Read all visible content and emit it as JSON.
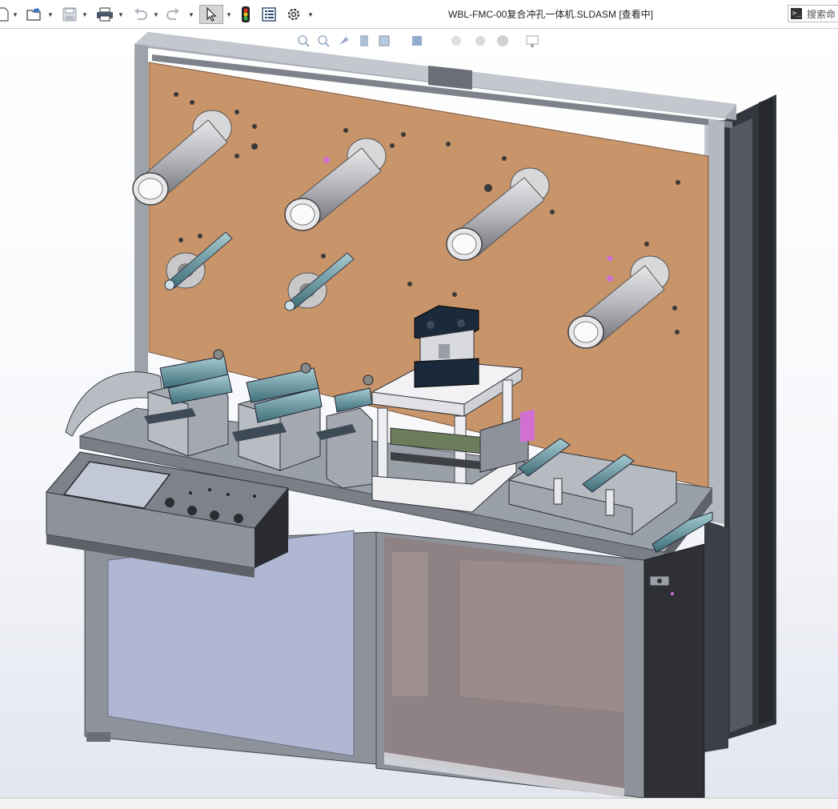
{
  "window": {
    "title": "WBL-FMC-00复合冲孔一体机.SLDASM [查看中]"
  },
  "toolbar": {
    "items": [
      {
        "icon": "new-document-icon",
        "has_dropdown": true
      },
      {
        "icon": "open-folder-icon",
        "has_dropdown": true
      },
      {
        "icon": "save-icon",
        "has_dropdown": true,
        "disabled": true
      },
      {
        "icon": "print-icon",
        "has_dropdown": true
      },
      {
        "icon": "undo-icon",
        "has_dropdown": true,
        "disabled": true
      },
      {
        "icon": "redo-icon",
        "has_dropdown": true,
        "disabled": true
      },
      {
        "icon": "select-pointer-icon",
        "has_dropdown": true,
        "active": true
      },
      {
        "icon": "traffic-light-icon",
        "has_dropdown": false
      },
      {
        "icon": "file-properties-icon",
        "has_dropdown": false
      },
      {
        "icon": "options-gear-icon",
        "has_dropdown": true
      }
    ]
  },
  "search": {
    "placeholder": "搜索命",
    "icon": "command-prompt-icon"
  },
  "heads_up_toolbar": {
    "icons": [
      "zoom-to-fit-icon",
      "zoom-area-icon",
      "previous-view-icon",
      "section-view-icon",
      "view-orientation-icon",
      "display-style-icon",
      "hide-show-icon",
      "edit-appearance-icon",
      "apply-scene-icon",
      "view-settings-icon"
    ]
  },
  "colors": {
    "panel_orange": "#c8946a",
    "frame_gray": "#9aa0a8",
    "dark_frame": "#33353b",
    "cabinet_panel": "#b0b7d2",
    "viewport_top": "#ffffff",
    "viewport_bottom": "#e3e6ef",
    "cylinder_dark": "#1a2a3a",
    "roller_teal": "#6aa0a8",
    "pink_part": "#d070d0"
  }
}
